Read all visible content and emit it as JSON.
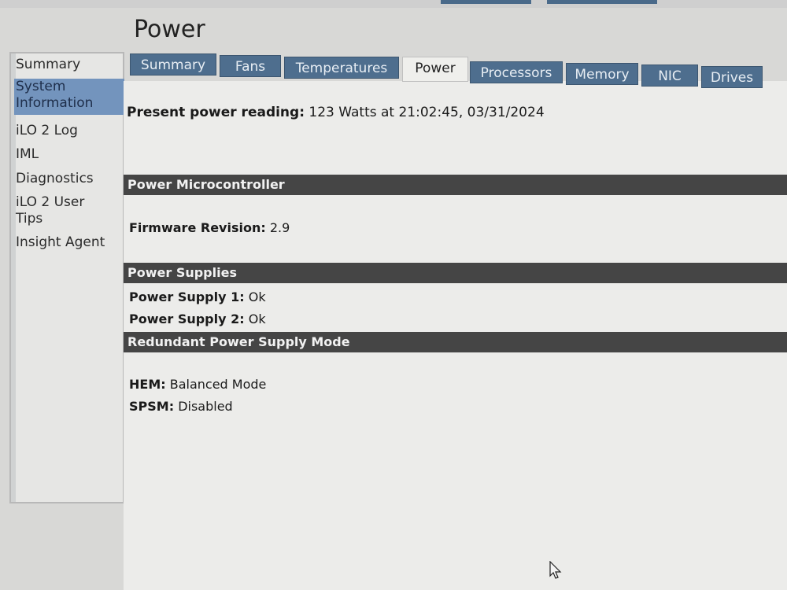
{
  "page": {
    "title": "Power"
  },
  "sidebar": {
    "items": [
      {
        "label": "Summary",
        "active": false
      },
      {
        "label": "System Information",
        "active": true
      },
      {
        "label": "iLO 2 Log",
        "active": false
      },
      {
        "label": "IML",
        "active": false
      },
      {
        "label": "Diagnostics",
        "active": false
      },
      {
        "label": "iLO 2 User Tips",
        "active": false
      },
      {
        "label": "Insight Agent",
        "active": false
      }
    ]
  },
  "tabs": [
    {
      "label": "Summary",
      "active": false
    },
    {
      "label": "Fans",
      "active": false
    },
    {
      "label": "Temperatures",
      "active": false
    },
    {
      "label": "Power",
      "active": true
    },
    {
      "label": "Processors",
      "active": false
    },
    {
      "label": "Memory",
      "active": false
    },
    {
      "label": "NIC",
      "active": false
    },
    {
      "label": "Drives",
      "active": false
    }
  ],
  "present_reading": {
    "label": "Present power reading:",
    "value": "123 Watts at 21:02:45, 03/31/2024"
  },
  "sections": {
    "microcontroller": {
      "title": "Power Microcontroller",
      "firmware_label": "Firmware Revision:",
      "firmware_value": "2.9"
    },
    "supplies": {
      "title": "Power Supplies",
      "items": [
        {
          "label": "Power Supply 1:",
          "value": "Ok"
        },
        {
          "label": "Power Supply 2:",
          "value": "Ok"
        }
      ]
    },
    "redundant": {
      "title": "Redundant Power Supply Mode",
      "hem_label": "HEM:",
      "hem_value": "Balanced Mode",
      "spsm_label": "SPSM:",
      "spsm_value": "Disabled"
    }
  },
  "colors": {
    "tab_bg": "#4e6e8e",
    "active_sidebar": "#7394bd",
    "section_bar": "#454545"
  }
}
